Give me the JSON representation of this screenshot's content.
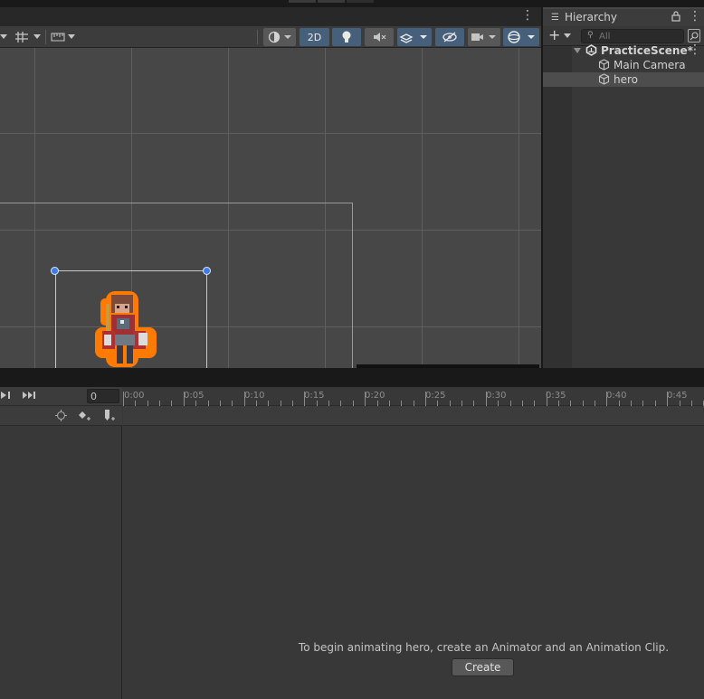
{
  "scene": {
    "toolbar": {
      "two_d_label": "2D"
    }
  },
  "hierarchy": {
    "title": "Hierarchy",
    "add_label": "+",
    "search_placeholder": "All",
    "items": [
      {
        "label": "PracticeScene*"
      },
      {
        "label": "Main Camera"
      },
      {
        "label": "hero"
      }
    ]
  },
  "animation": {
    "frame_value": "0",
    "ruler_labels": [
      "0:00",
      "0:05",
      "0:10",
      "0:15",
      "0:20",
      "0:25",
      "0:30",
      "0:35",
      "0:40",
      "0:45"
    ],
    "message": "To begin animating hero, create an Animator and an Animation Clip.",
    "create_label": "Create"
  },
  "colors": {
    "accent_blue": "#46607c",
    "handle_blue": "#3d7ee6",
    "selection_orange": "#ff7a00"
  }
}
